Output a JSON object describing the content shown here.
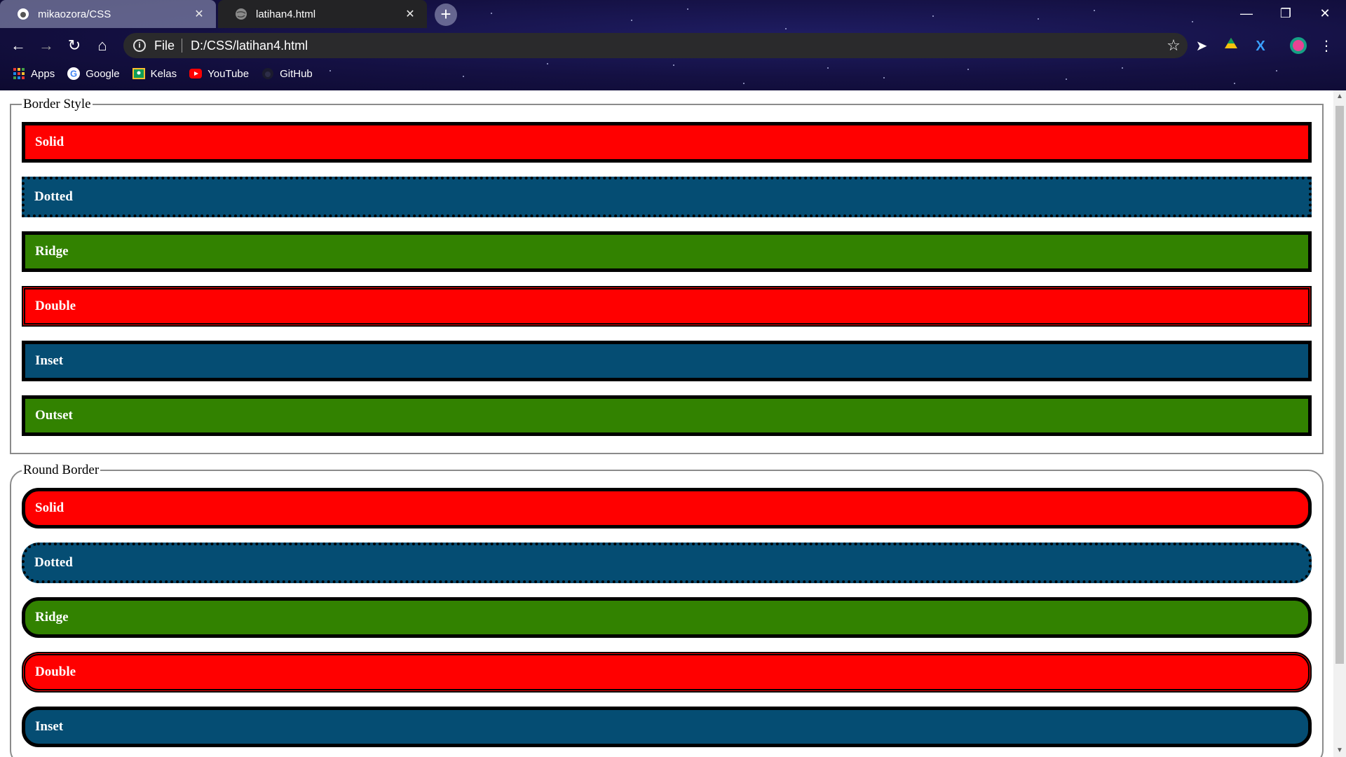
{
  "tabs": [
    {
      "title": "mikaozora/CSS",
      "favicon": "github-icon",
      "active": false
    },
    {
      "title": "latihan4.html",
      "favicon": "globe-icon",
      "active": true
    }
  ],
  "address_bar": {
    "scheme": "File",
    "url": "D:/CSS/latihan4.html"
  },
  "bookmarks": [
    {
      "label": "Apps",
      "icon": "apps-grid-icon"
    },
    {
      "label": "Google",
      "icon": "google-icon"
    },
    {
      "label": "Kelas",
      "icon": "classroom-icon"
    },
    {
      "label": "YouTube",
      "icon": "youtube-icon"
    },
    {
      "label": "GitHub",
      "icon": "github-icon"
    }
  ],
  "colors": {
    "red": "#ff0000",
    "blue": "#054d73",
    "green": "#328200"
  },
  "groups": [
    {
      "legend": "Border Style",
      "boxes": [
        {
          "label": "Solid",
          "color": "red",
          "style": "solid"
        },
        {
          "label": "Dotted",
          "color": "blue",
          "style": "dotted"
        },
        {
          "label": "Ridge",
          "color": "green",
          "style": "ridge"
        },
        {
          "label": "Double",
          "color": "red",
          "style": "double"
        },
        {
          "label": "Inset",
          "color": "blue",
          "style": "inset"
        },
        {
          "label": "Outset",
          "color": "green",
          "style": "outset"
        }
      ]
    },
    {
      "legend": "Round Border",
      "boxes": [
        {
          "label": "Solid",
          "color": "red",
          "style": "solid"
        },
        {
          "label": "Dotted",
          "color": "blue",
          "style": "dotted"
        },
        {
          "label": "Ridge",
          "color": "green",
          "style": "ridge"
        },
        {
          "label": "Double",
          "color": "red",
          "style": "double"
        },
        {
          "label": "Inset",
          "color": "blue",
          "style": "inset"
        }
      ]
    }
  ]
}
